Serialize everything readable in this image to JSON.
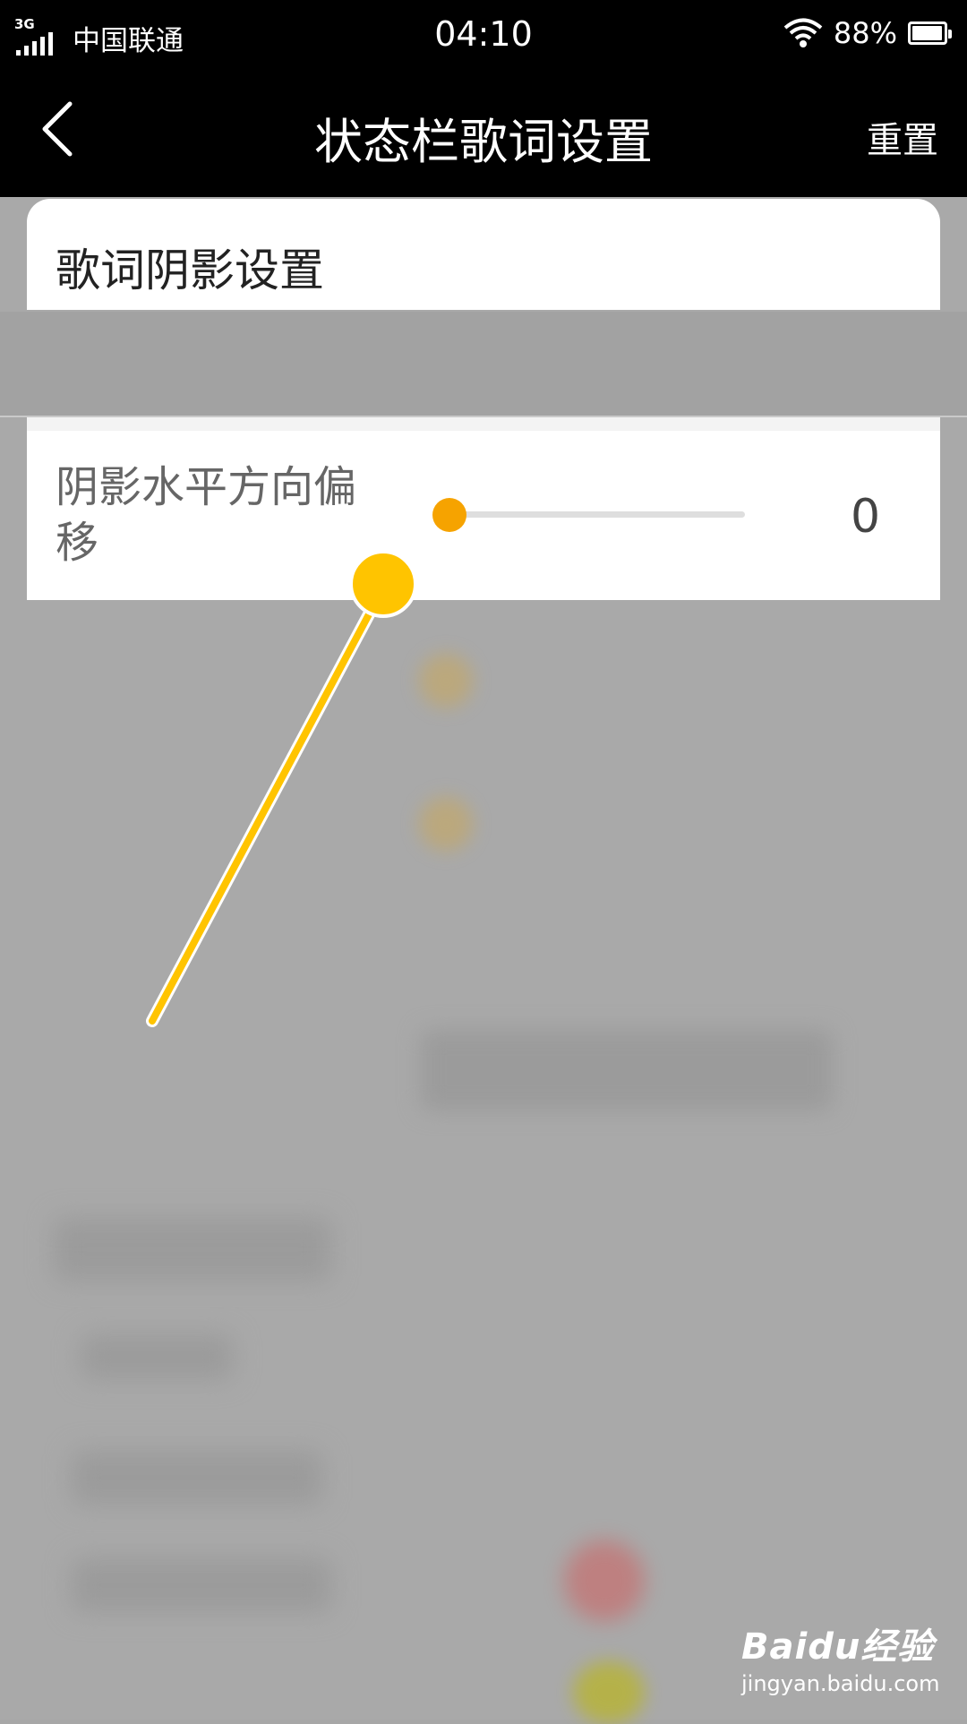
{
  "status_bar": {
    "network_type": "3G",
    "carrier": "中国联通",
    "time": "04:10",
    "battery": "88%",
    "battery_level": 0.88,
    "icons": [
      "signal-icon",
      "wifi-icon",
      "battery-icon"
    ]
  },
  "nav": {
    "back_icon": "chevron-left-icon",
    "title": "状态栏歌词设置",
    "reset_label": "重置"
  },
  "card": {
    "title": "歌词阴影设置"
  },
  "offset_setting": {
    "label": "阴影水平方向偏移",
    "value": "0",
    "slider_fraction": 0
  },
  "watermark": {
    "brand": "Baidu经验",
    "url": "jingyan.baidu.com"
  },
  "colors": {
    "bar_bg": "#000000",
    "slider_thumb": "#f6a300",
    "annotation": "#ffc400",
    "overlay": "#a9a9a9"
  }
}
